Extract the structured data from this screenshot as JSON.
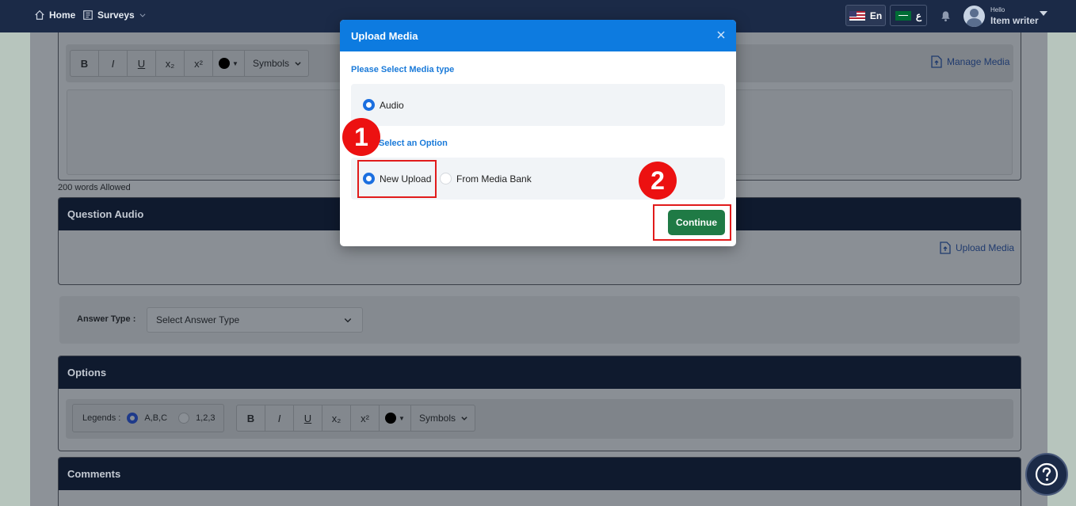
{
  "topbar": {
    "home_label": "Home",
    "surveys_label": "Surveys",
    "lang_en": "En",
    "lang_ar": "ع",
    "user_greeting": "Hello",
    "user_name": "Item writer"
  },
  "editor_toolbar": {
    "bold": "B",
    "italic": "I",
    "underline": "U",
    "subscript": "x₂",
    "superscript": "x²",
    "symbols": "Symbols"
  },
  "manage_media_label": "Manage Media",
  "words_allowed": "200 words Allowed",
  "question_audio": {
    "title": "Question Audio",
    "upload_media_label": "Upload Media"
  },
  "answer_type": {
    "label": "Answer Type :",
    "placeholder": "Select Answer Type"
  },
  "options_section": {
    "title": "Options",
    "legends_label": "Legends :",
    "legend_abc": "A,B,C",
    "legend_123": "1,2,3",
    "legend_selected": "A,B,C"
  },
  "comments_section": {
    "title": "Comments"
  },
  "modal": {
    "title": "Upload Media",
    "media_type_label": "Please Select Media type",
    "media_type_option": "Audio",
    "option_label": "Select an Option",
    "option_new_upload": "New Upload",
    "option_media_bank": "From Media Bank",
    "selected_option": "New Upload",
    "continue_label": "Continue"
  },
  "annotations": {
    "step1": "1",
    "step2": "2"
  },
  "colors": {
    "topbar": "#1b2a47",
    "modal_header": "#0d7be0",
    "continue_button": "#1f7a45",
    "highlight": "#e11b1b"
  }
}
